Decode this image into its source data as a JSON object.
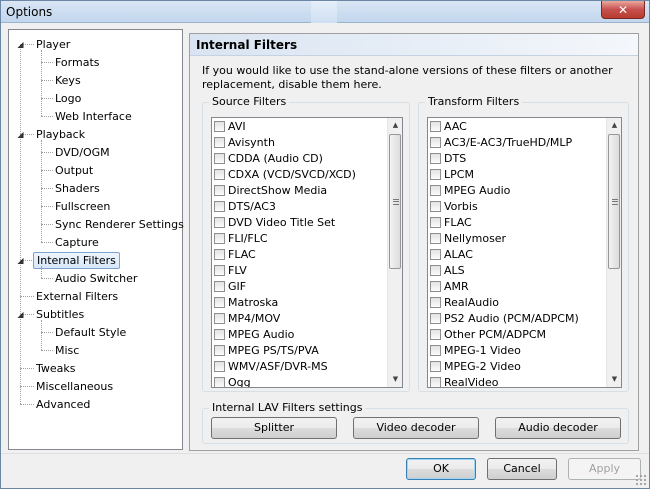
{
  "window": {
    "title": "Options",
    "close_glyph": "✕"
  },
  "tree": {
    "nodes": [
      {
        "label": "Player",
        "expander": "◢"
      },
      {
        "label": "Formats"
      },
      {
        "label": "Keys"
      },
      {
        "label": "Logo"
      },
      {
        "label": "Web Interface"
      },
      {
        "label": "Playback",
        "expander": "◢"
      },
      {
        "label": "DVD/OGM"
      },
      {
        "label": "Output"
      },
      {
        "label": "Shaders"
      },
      {
        "label": "Fullscreen"
      },
      {
        "label": "Sync Renderer Settings"
      },
      {
        "label": "Capture"
      },
      {
        "label": "Internal Filters",
        "expander": "◢",
        "selected": true
      },
      {
        "label": "Audio Switcher"
      },
      {
        "label": "External Filters"
      },
      {
        "label": "Subtitles",
        "expander": "◢"
      },
      {
        "label": "Default Style"
      },
      {
        "label": "Misc"
      },
      {
        "label": "Tweaks"
      },
      {
        "label": "Miscellaneous"
      },
      {
        "label": "Advanced"
      }
    ]
  },
  "page": {
    "header": "Internal Filters",
    "description": "If you would like to use the stand-alone versions of these filters or another replacement, disable them here."
  },
  "source_filters": {
    "label": "Source Filters",
    "items": [
      "AVI",
      "Avisynth",
      "CDDA (Audio CD)",
      "CDXA (VCD/SVCD/XCD)",
      "DirectShow Media",
      "DTS/AC3",
      "DVD Video Title Set",
      "FLI/FLC",
      "FLAC",
      "FLV",
      "GIF",
      "Matroska",
      "MP4/MOV",
      "MPEG Audio",
      "MPEG PS/TS/PVA",
      "WMV/ASF/DVR-MS",
      "Ogg"
    ]
  },
  "transform_filters": {
    "label": "Transform Filters",
    "items": [
      "AAC",
      "AC3/E-AC3/TrueHD/MLP",
      "DTS",
      "LPCM",
      "MPEG Audio",
      "Vorbis",
      "FLAC",
      "Nellymoser",
      "ALAC",
      "ALS",
      "AMR",
      "RealAudio",
      "PS2 Audio (PCM/ADPCM)",
      "Other PCM/ADPCM",
      "MPEG-1 Video",
      "MPEG-2 Video",
      "RealVideo"
    ]
  },
  "lav": {
    "label": "Internal LAV Filters settings",
    "splitter": "Splitter",
    "video_decoder": "Video decoder",
    "audio_decoder": "Audio decoder"
  },
  "buttons": {
    "ok": "OK",
    "cancel": "Cancel",
    "apply": "Apply"
  },
  "scrollbar": {
    "up_glyph": "▲",
    "down_glyph": "▼"
  },
  "colors": {
    "selection_border": "#7da2ce",
    "header_gradient_start": "#d9e4f2"
  }
}
